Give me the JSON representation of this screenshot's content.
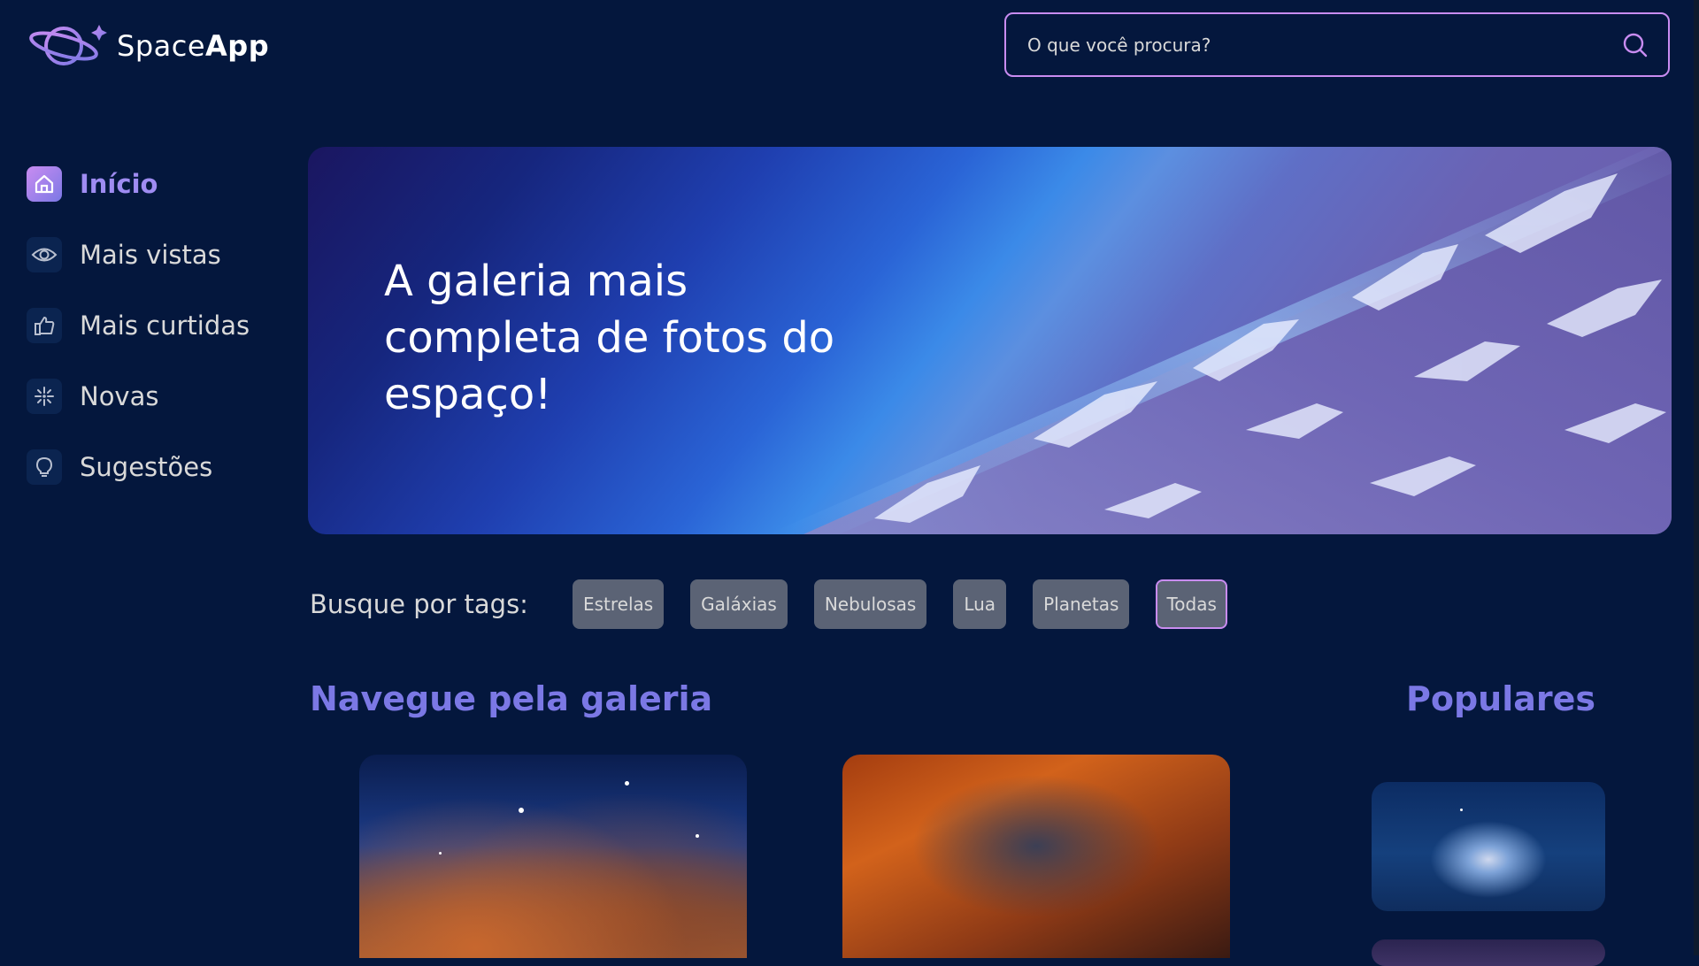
{
  "app": {
    "name_light": "Space",
    "name_bold": "App"
  },
  "search": {
    "placeholder": "O que você procura?",
    "value": "",
    "icon": "search-icon"
  },
  "sidebar": {
    "items": [
      {
        "label": "Início",
        "icon": "home-icon",
        "active": true
      },
      {
        "label": "Mais vistas",
        "icon": "eye-icon",
        "active": false
      },
      {
        "label": "Mais curtidas",
        "icon": "thumbs-up-icon",
        "active": false
      },
      {
        "label": "Novas",
        "icon": "sparkle-icon",
        "active": false
      },
      {
        "label": "Sugestões",
        "icon": "lightbulb-icon",
        "active": false
      }
    ]
  },
  "banner": {
    "title": "A galeria mais completa de fotos do espaço!"
  },
  "tags": {
    "label": "Busque por tags:",
    "items": [
      "Estrelas",
      "Galáxias",
      "Nebulosas",
      "Lua",
      "Planetas",
      "Todas"
    ],
    "selected": "Todas"
  },
  "gallery": {
    "title": "Navegue pela galeria"
  },
  "popular": {
    "title": "Populares"
  },
  "colors": {
    "background": "#04173d",
    "accent_purple": "#7b78e5",
    "accent_pink": "#c98cf1",
    "tag_bg": "#5b6375",
    "text": "#d9d9d9"
  }
}
